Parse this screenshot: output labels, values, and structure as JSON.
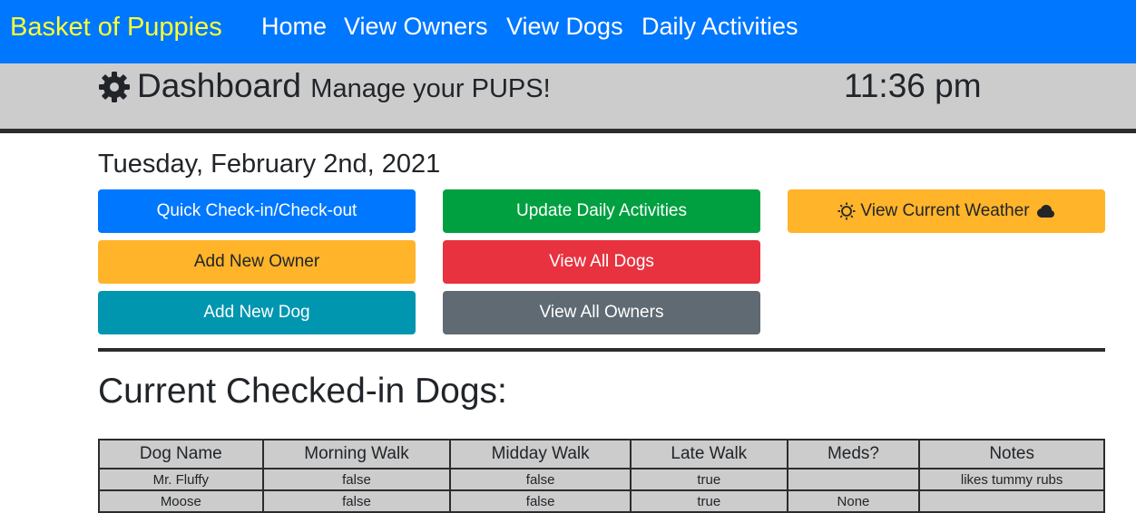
{
  "navbar": {
    "brand": "Basket of Puppies",
    "links": [
      "Home",
      "View Owners",
      "View Dogs",
      "Daily Activities"
    ]
  },
  "header": {
    "icon": "gear-icon",
    "title": "Dashboard",
    "subtitle": "Manage your PUPS!",
    "time": "11:36 pm"
  },
  "date": "Tuesday, February 2nd, 2021",
  "buttons": {
    "quick_checkin": "Quick Check-in/Check-out",
    "update_activities": "Update Daily Activities",
    "view_weather": "View Current Weather",
    "add_owner": "Add New Owner",
    "view_all_dogs": "View All Dogs",
    "add_dog": "Add New Dog",
    "view_all_owners": "View All Owners"
  },
  "weather_icons": [
    "sun-icon",
    "cloud-icon"
  ],
  "section_title": "Current Checked-in Dogs:",
  "table": {
    "headers": [
      "Dog Name",
      "Morning Walk",
      "Midday Walk",
      "Late Walk",
      "Meds?",
      "Notes"
    ],
    "rows": [
      [
        "Mr. Fluffy",
        "false",
        "false",
        "true",
        "",
        "likes tummy rubs"
      ],
      [
        "Moose",
        "false",
        "false",
        "true",
        "None",
        ""
      ]
    ]
  },
  "colors": {
    "navbar": "#0077ff",
    "brand": "#ffff33",
    "primary": "#0077ff",
    "success": "#00a040",
    "warning": "#ffb42a",
    "danger": "#e8323f",
    "info": "#0096b0",
    "secondary": "#5f6a72"
  }
}
